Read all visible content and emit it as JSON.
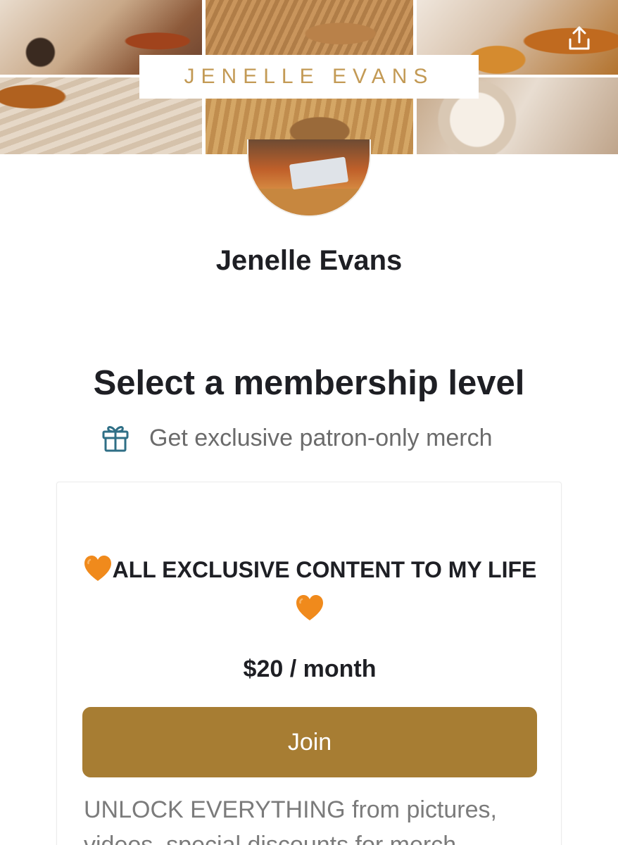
{
  "banner": {
    "title": "JENELLE EVANS",
    "share_icon": "share-upload-icon"
  },
  "creator": {
    "name": "Jenelle Evans"
  },
  "membership": {
    "heading": "Select a membership level",
    "perk_icon": "gift-icon",
    "perk_text": "Get exclusive patron-only merch"
  },
  "tier": {
    "title": "ALL EXCLUSIVE CONTENT TO MY LIFE",
    "title_emoji": "orange-heart-icon",
    "price": "$20 / month",
    "join_label": "Join",
    "description": "UNLOCK EVERYTHING from pictures, videos, special discounts for merch"
  },
  "colors": {
    "accent": "#a77d33",
    "title_gold": "#c39a55",
    "heart": "#f08a1c",
    "gift": "#2f6f86"
  }
}
